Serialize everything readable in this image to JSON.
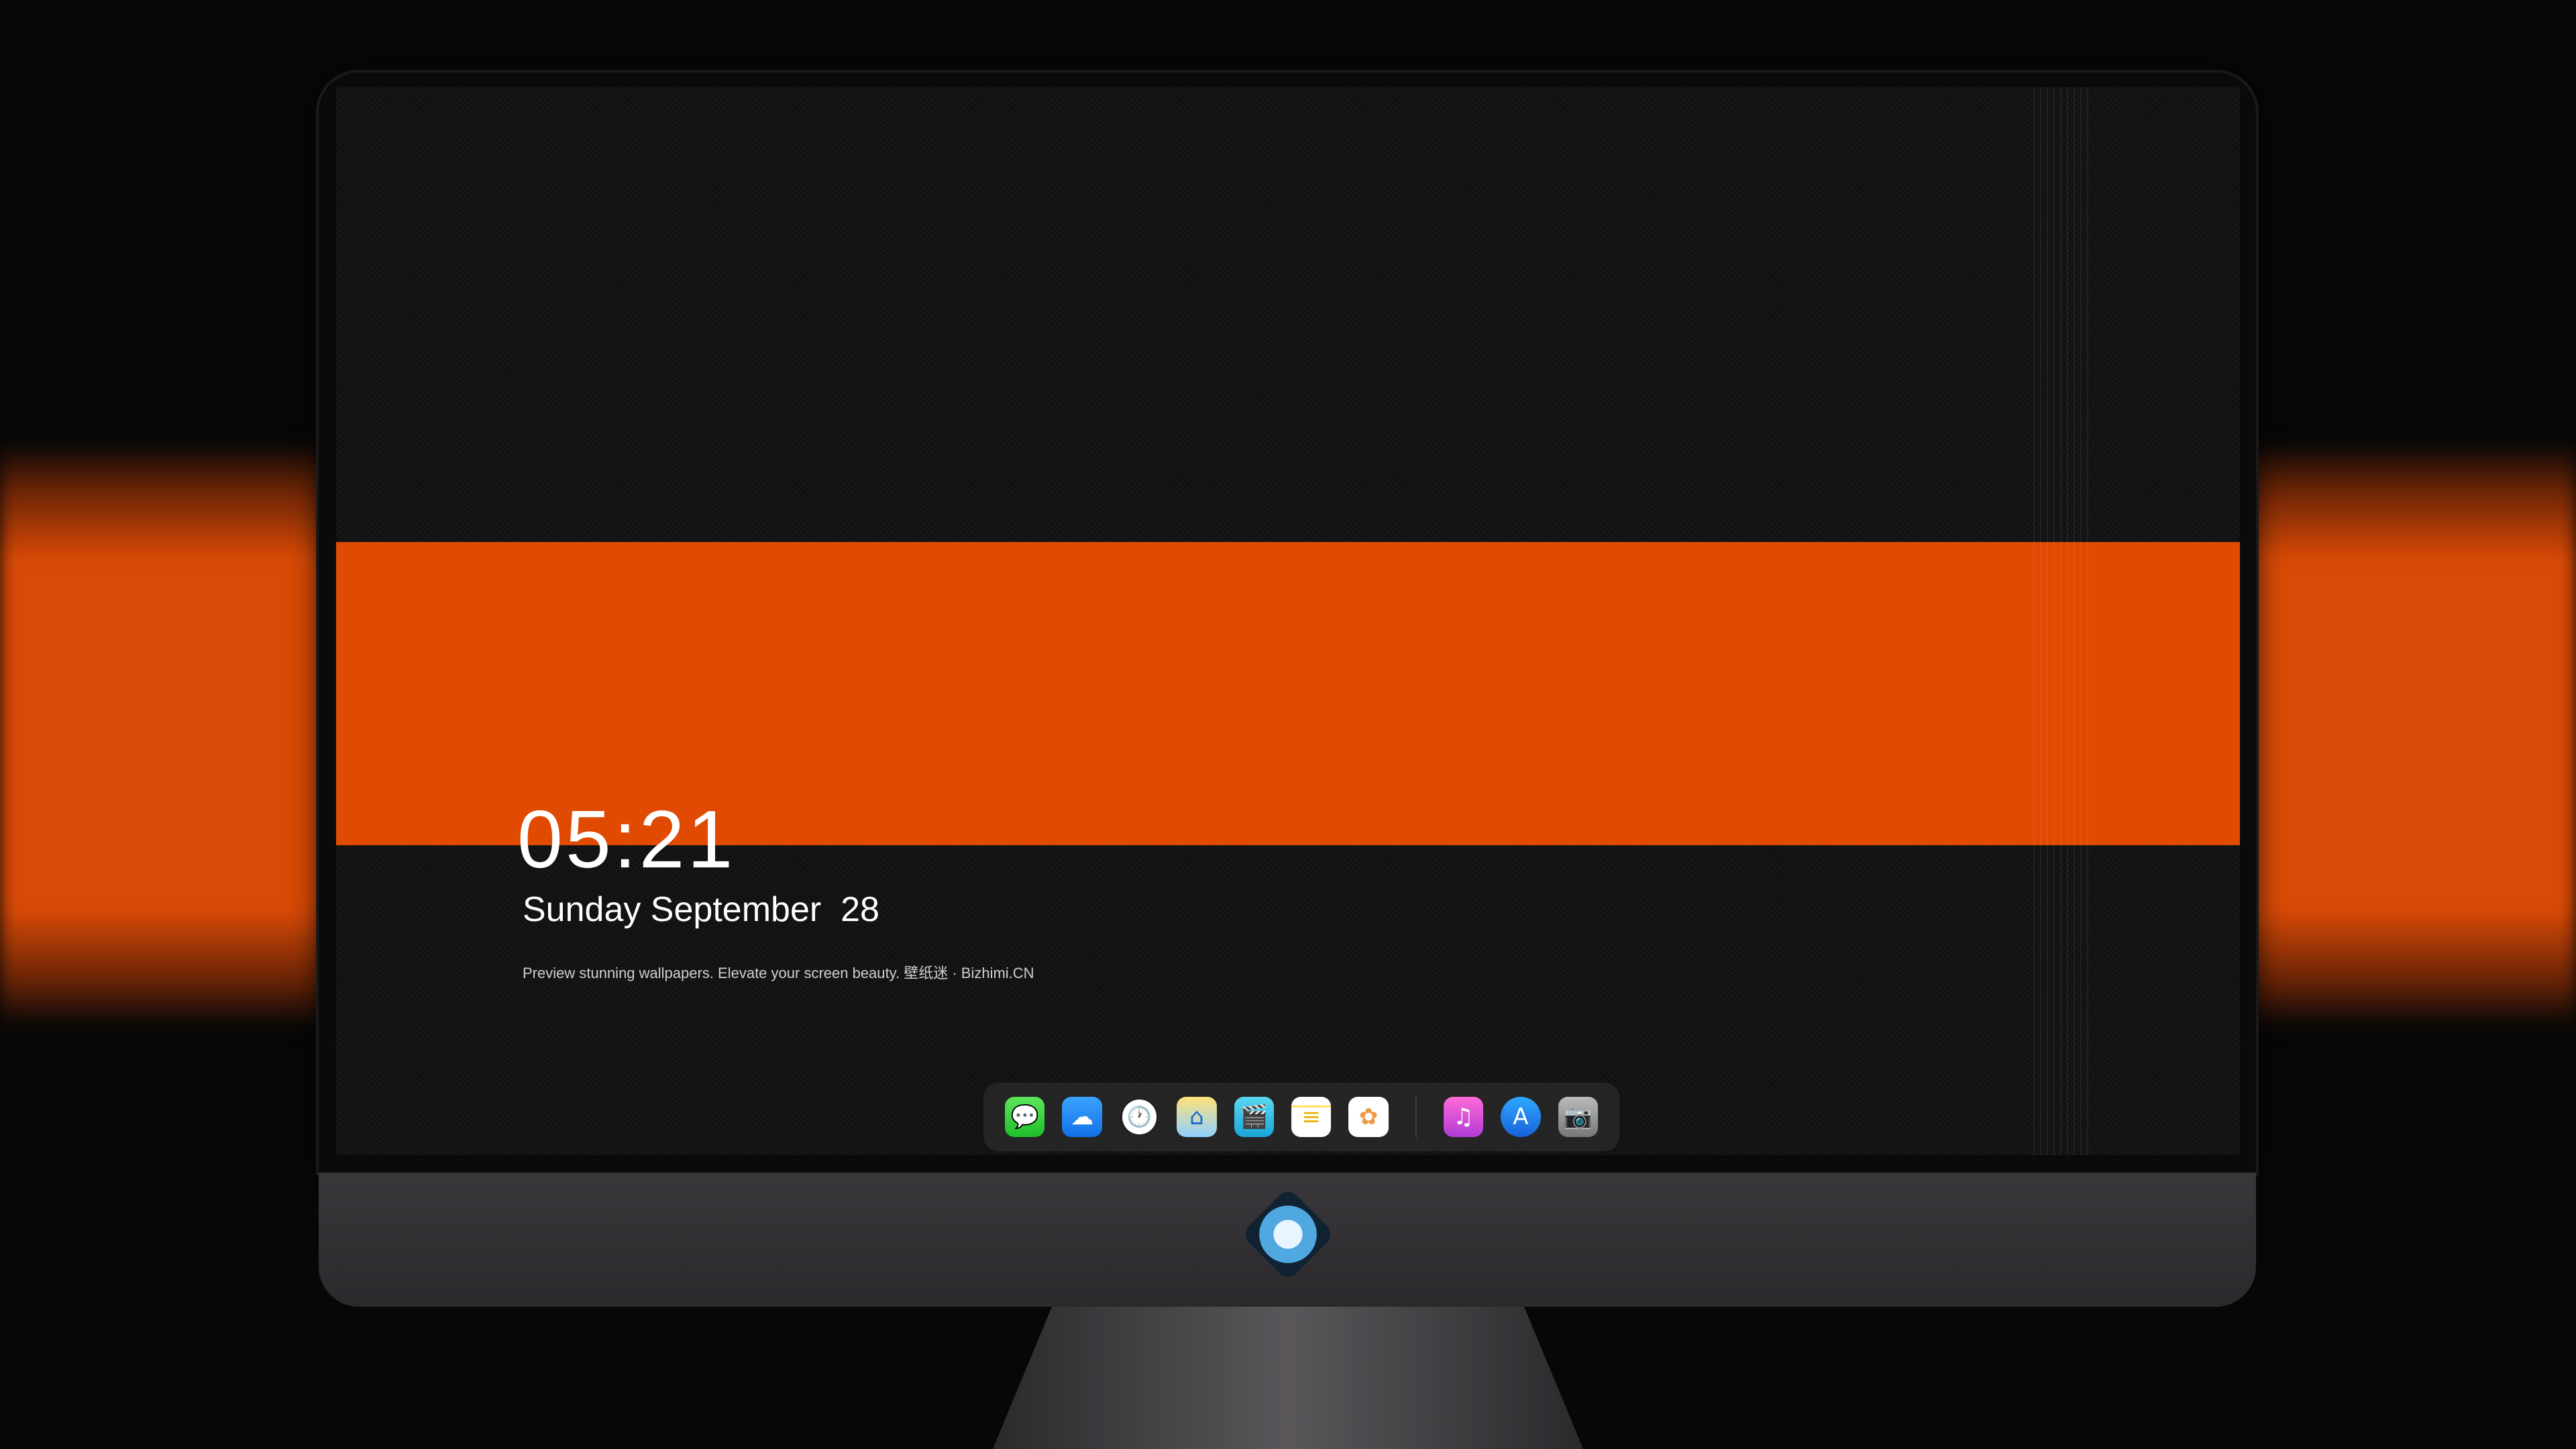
{
  "lock_screen": {
    "time": "05:21",
    "date": "Sunday September  28",
    "tagline": "Preview stunning wallpapers. Elevate your screen beauty. 壁纸迷 · Bizhimi.CN"
  },
  "dock": {
    "apps": [
      {
        "name": "messages-icon",
        "glyph": "💬"
      },
      {
        "name": "weather-icon",
        "glyph": "☁"
      },
      {
        "name": "clock-icon",
        "glyph": "🕐"
      },
      {
        "name": "maps-icon",
        "glyph": "⌂"
      },
      {
        "name": "clips-icon",
        "glyph": "🎬"
      },
      {
        "name": "notes-icon",
        "glyph": "≡"
      },
      {
        "name": "photos-icon",
        "glyph": "✿"
      },
      {
        "name": "music-icon",
        "glyph": "♫"
      },
      {
        "name": "app-store-icon",
        "glyph": "A"
      },
      {
        "name": "camera-icon",
        "glyph": "📷"
      }
    ]
  },
  "colors": {
    "accent_orange": "#e04a02",
    "background": "#070707",
    "bezel": "#0a0a0a",
    "chin": "#3a373b"
  }
}
